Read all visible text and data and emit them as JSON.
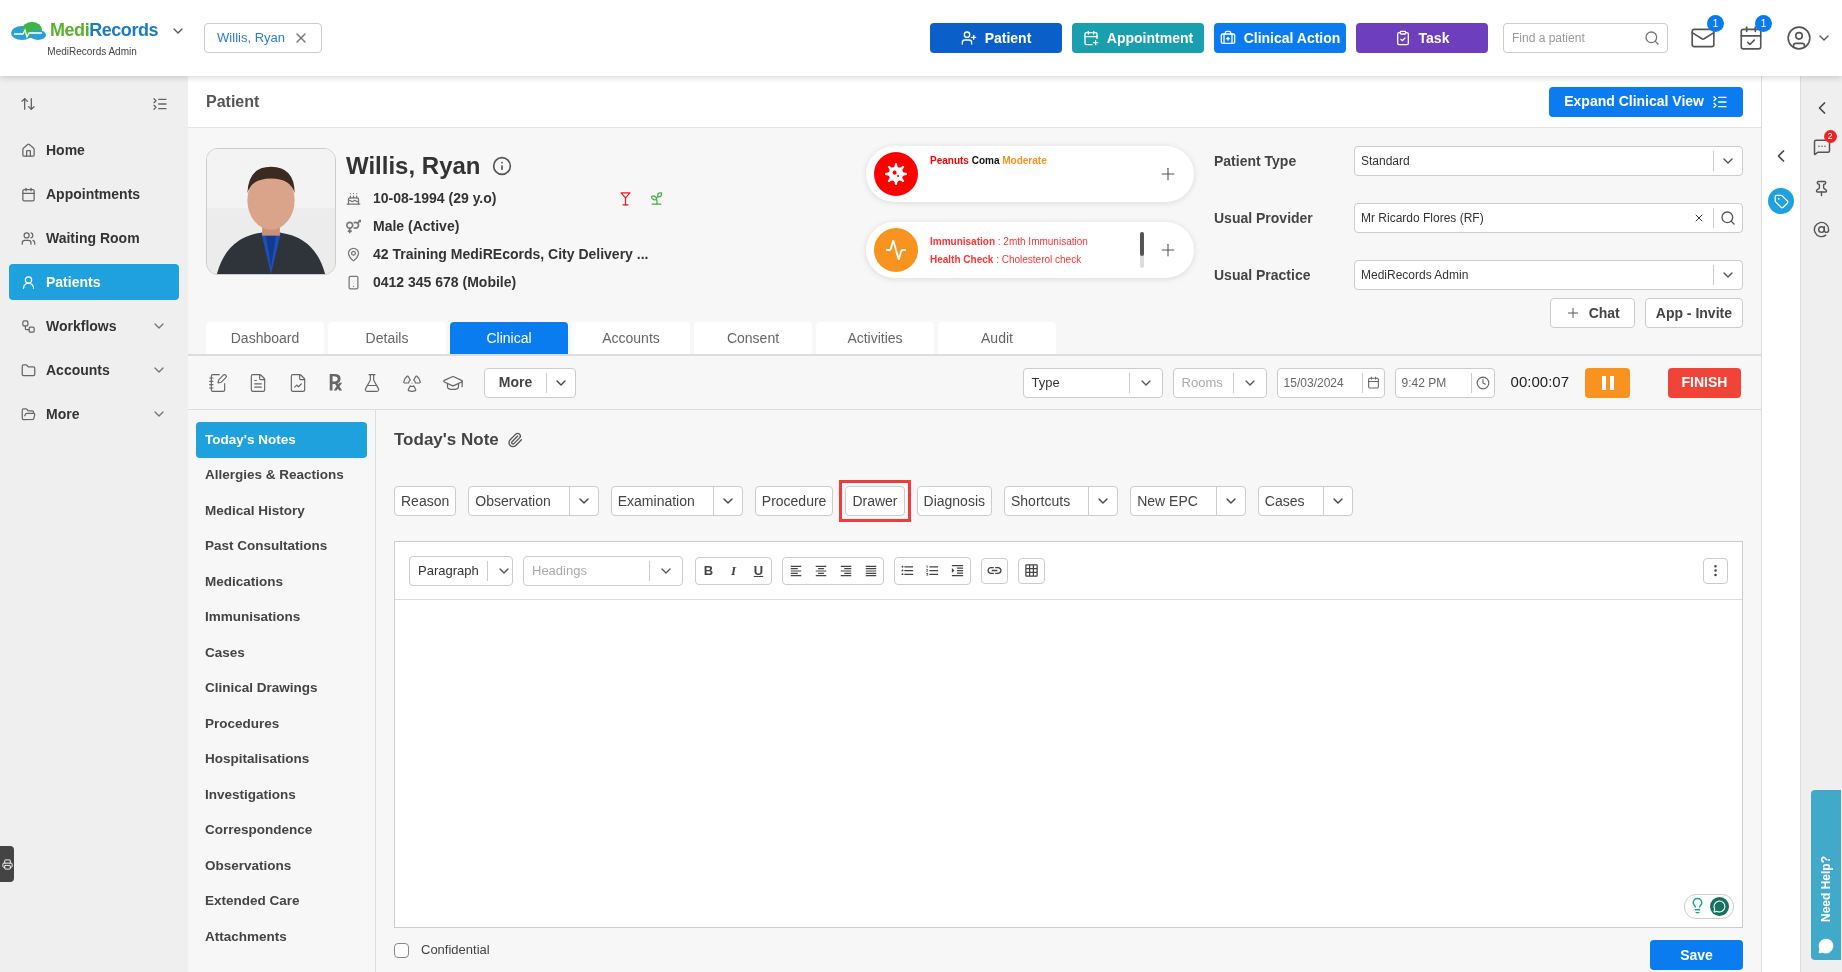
{
  "app": {
    "brand_prefix": "Medi",
    "brand_suffix": "Records",
    "subtitle": "MediRecords Admin"
  },
  "open_patient_tab": {
    "label": "Willis, Ryan"
  },
  "top_actions": [
    {
      "kind": "patient",
      "label": "Patient"
    },
    {
      "kind": "appointment",
      "label": "Appointment"
    },
    {
      "kind": "clinical",
      "label": "Clinical Action"
    },
    {
      "kind": "task",
      "label": "Task"
    }
  ],
  "search": {
    "placeholder": "Find a patient"
  },
  "notifications": {
    "mail": "1",
    "calendar": "1"
  },
  "sidebar": {
    "items": [
      {
        "kind": "home",
        "label": "Home",
        "selected": false,
        "has_menu": false
      },
      {
        "kind": "calendar",
        "label": "Appointments",
        "selected": false,
        "has_menu": false
      },
      {
        "kind": "waiting",
        "label": "Waiting Room",
        "selected": false,
        "has_menu": false
      },
      {
        "kind": "patients",
        "label": "Patients",
        "selected": true,
        "has_menu": false
      },
      {
        "kind": "workflows",
        "label": "Workflows",
        "selected": false,
        "has_menu": true
      },
      {
        "kind": "accounts",
        "label": "Accounts",
        "selected": false,
        "has_menu": true
      },
      {
        "kind": "more",
        "label": "More",
        "selected": false,
        "has_menu": true
      }
    ]
  },
  "page_title": "Patient",
  "expand_button": "Expand Clinical View",
  "patient": {
    "name": "Willis, Ryan",
    "dob": "10-08-1994 (29 y.o)",
    "gender": "Male (Active)",
    "address": "42 Training MediREcords, City Delivery ...",
    "phone": "0412 345 678 (Mobile)"
  },
  "allergy": {
    "substance": "Peanuts",
    "reaction": "Coma",
    "severity": "Moderate"
  },
  "reminders": [
    {
      "label": "Immunisation",
      "text": " : 2mth Immunisation"
    },
    {
      "label": "Health Check",
      "text": " : Cholesterol check"
    }
  ],
  "fields": [
    {
      "kind": "select",
      "label": "Patient Type",
      "value": "Standard"
    },
    {
      "kind": "lookup",
      "label": "Usual Provider",
      "value": "Mr Ricardo Flores (RF)"
    },
    {
      "kind": "select",
      "label": "Usual Practice",
      "value": "MediRecords Admin"
    }
  ],
  "chat_button": "Chat",
  "invite_button": "App - Invite",
  "tabs": [
    {
      "label": "Dashboard",
      "selected": false
    },
    {
      "label": "Details",
      "selected": false
    },
    {
      "label": "Clinical",
      "selected": true
    },
    {
      "label": "Accounts",
      "selected": false
    },
    {
      "label": "Consent",
      "selected": false
    },
    {
      "label": "Activities",
      "selected": false
    },
    {
      "label": "Audit",
      "selected": false
    }
  ],
  "toolbar": {
    "rx": "℞",
    "more": "More",
    "type_placeholder": "Type",
    "rooms_placeholder": "Rooms",
    "date": "15/03/2024",
    "time": "9:42 PM",
    "timer": "00:00:07",
    "finish": "FINISH"
  },
  "note_menu": [
    {
      "label": "Today's Notes",
      "selected": true
    },
    {
      "label": "Allergies & Reactions",
      "selected": false
    },
    {
      "label": "Medical History",
      "selected": false
    },
    {
      "label": "Past Consultations",
      "selected": false
    },
    {
      "label": "Medications",
      "selected": false
    },
    {
      "label": "Immunisations",
      "selected": false
    },
    {
      "label": "Cases",
      "selected": false
    },
    {
      "label": "Clinical Drawings",
      "selected": false
    },
    {
      "label": "Procedures",
      "selected": false
    },
    {
      "label": "Hospitalisations",
      "selected": false
    },
    {
      "label": "Investigations",
      "selected": false
    },
    {
      "label": "Correspondence",
      "selected": false
    },
    {
      "label": "Observations",
      "selected": false
    },
    {
      "label": "Extended Care",
      "selected": false
    },
    {
      "label": "Attachments",
      "selected": false
    }
  ],
  "note_title": "Today's Note",
  "note_sections": [
    {
      "label": "Reason",
      "has_menu": false,
      "highlighted": false
    },
    {
      "label": "Observation",
      "has_menu": true,
      "highlighted": false
    },
    {
      "label": "Examination",
      "has_menu": true,
      "highlighted": false
    },
    {
      "label": "Procedure",
      "has_menu": false,
      "highlighted": false
    },
    {
      "label": "Drawer",
      "has_menu": false,
      "highlighted": true
    },
    {
      "label": "Diagnosis",
      "has_menu": false,
      "highlighted": false
    },
    {
      "label": "Shortcuts",
      "has_menu": true,
      "highlighted": false
    },
    {
      "label": "New EPC",
      "has_menu": true,
      "highlighted": false
    },
    {
      "label": "Cases",
      "has_menu": true,
      "highlighted": false
    }
  ],
  "editor": {
    "block_format": "Paragraph",
    "headings_placeholder": "Headings",
    "bold": "B",
    "italic": "I",
    "underline": "U"
  },
  "confidential": {
    "label": "Confidential",
    "checked": false
  },
  "save_button": "Save",
  "right_rail": {
    "chat_badge": "2"
  },
  "help_tab": "Need Help?"
}
